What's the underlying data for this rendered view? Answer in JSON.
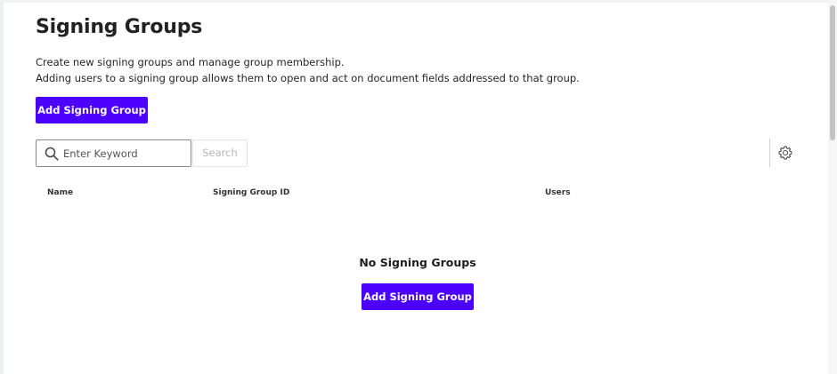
{
  "page": {
    "title": "Signing Groups",
    "description_line1": "Create new signing groups and manage group membership.",
    "description_line2": "Adding users to a signing group allows them to open and act on document fields addressed to that group.",
    "add_button_label": "Add Signing Group"
  },
  "toolbar": {
    "search_placeholder": "Enter Keyword",
    "search_value": "",
    "search_button_label": "Search",
    "search_icon": "magnifier-icon",
    "settings_icon": "gear-icon"
  },
  "table": {
    "columns": [
      "Name",
      "Signing Group ID",
      "Users"
    ],
    "rows": []
  },
  "empty_state": {
    "title": "No Signing Groups",
    "button_label": "Add Signing Group"
  },
  "colors": {
    "accent": "#4c00ff",
    "text": "#1e1e1e",
    "disabled_text": "#b8b8b8",
    "border": "#8a8a8a"
  }
}
